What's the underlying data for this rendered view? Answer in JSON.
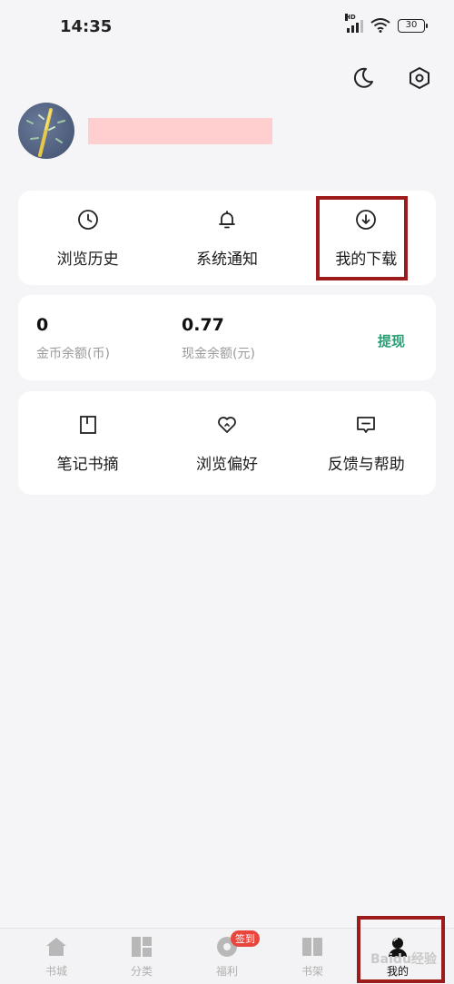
{
  "status": {
    "time": "14:35",
    "network": "HD",
    "battery": "30"
  },
  "header": {
    "theme_icon": "moon-icon",
    "settings_icon": "settings-hexagon-icon"
  },
  "profile": {
    "username_masked": true
  },
  "shortcuts": [
    {
      "label": "浏览历史",
      "icon": "clock-icon"
    },
    {
      "label": "系统通知",
      "icon": "bell-icon"
    },
    {
      "label": "我的下载",
      "icon": "download-circle-icon",
      "highlighted": true
    }
  ],
  "wallet": {
    "coins_value": "0",
    "coins_label": "金币余额(币)",
    "cash_value": "0.77",
    "cash_label": "现金余额(元)",
    "withdraw_label": "提现"
  },
  "tools": [
    {
      "label": "笔记书摘",
      "icon": "bookmark-note-icon"
    },
    {
      "label": "浏览偏好",
      "icon": "heart-icon"
    },
    {
      "label": "反馈与帮助",
      "icon": "feedback-message-icon"
    }
  ],
  "tabbar": {
    "tabs": [
      {
        "label": "书城",
        "icon": "home-icon"
      },
      {
        "label": "分类",
        "icon": "category-icon"
      },
      {
        "label": "福利",
        "icon": "welfare-icon",
        "badge": "签到"
      },
      {
        "label": "书架",
        "icon": "bookshelf-icon"
      },
      {
        "label": "我的",
        "icon": "profile-icon",
        "active": true
      }
    ]
  },
  "colors": {
    "accent_green": "#2a9d74",
    "highlight_red": "#9e1b1b",
    "badge_red": "#e8453c"
  },
  "watermark": "Baidu经验"
}
